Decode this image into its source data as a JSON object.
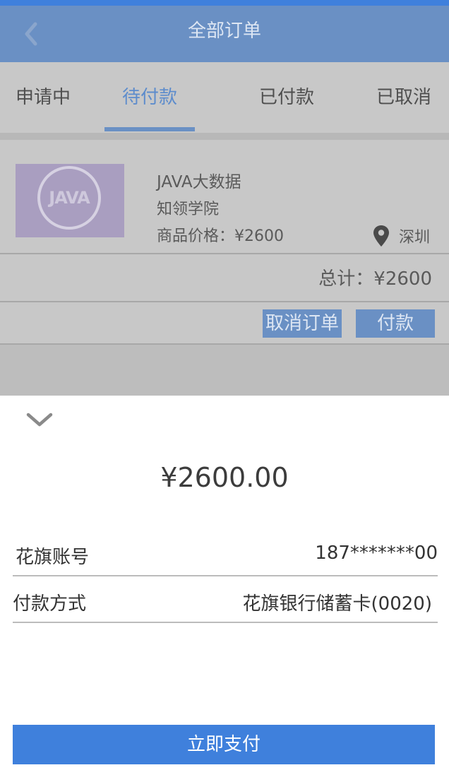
{
  "colors": {
    "accent": "#3f80dc",
    "header_dimmed": "#6a90c4",
    "overlay_gray": "#c8c8c8"
  },
  "header": {
    "title": "全部订单",
    "back_icon": "chevron-left-icon"
  },
  "tabs": [
    {
      "label": "申请中",
      "active": false
    },
    {
      "label": "待付款",
      "active": true
    },
    {
      "label": "已付款",
      "active": false
    },
    {
      "label": "已取消",
      "active": false
    }
  ],
  "order": {
    "thumbnail_text": "JAVA",
    "name": "JAVA大数据",
    "school": "知领学院",
    "price": "商品价格：¥2600",
    "location_icon": "map-pin-icon",
    "location": "深圳",
    "total": "总计：¥2600",
    "cancel_label": "取消订单",
    "pay_label": "付款"
  },
  "payment": {
    "collapse_icon": "chevron-down-icon",
    "amount": "¥2600.00",
    "rows": [
      {
        "label": "花旗账号",
        "value": "187*******00"
      },
      {
        "label": "付款方式",
        "value": "花旗银行储蓄卡(0020)"
      }
    ],
    "submit_label": "立即支付"
  }
}
